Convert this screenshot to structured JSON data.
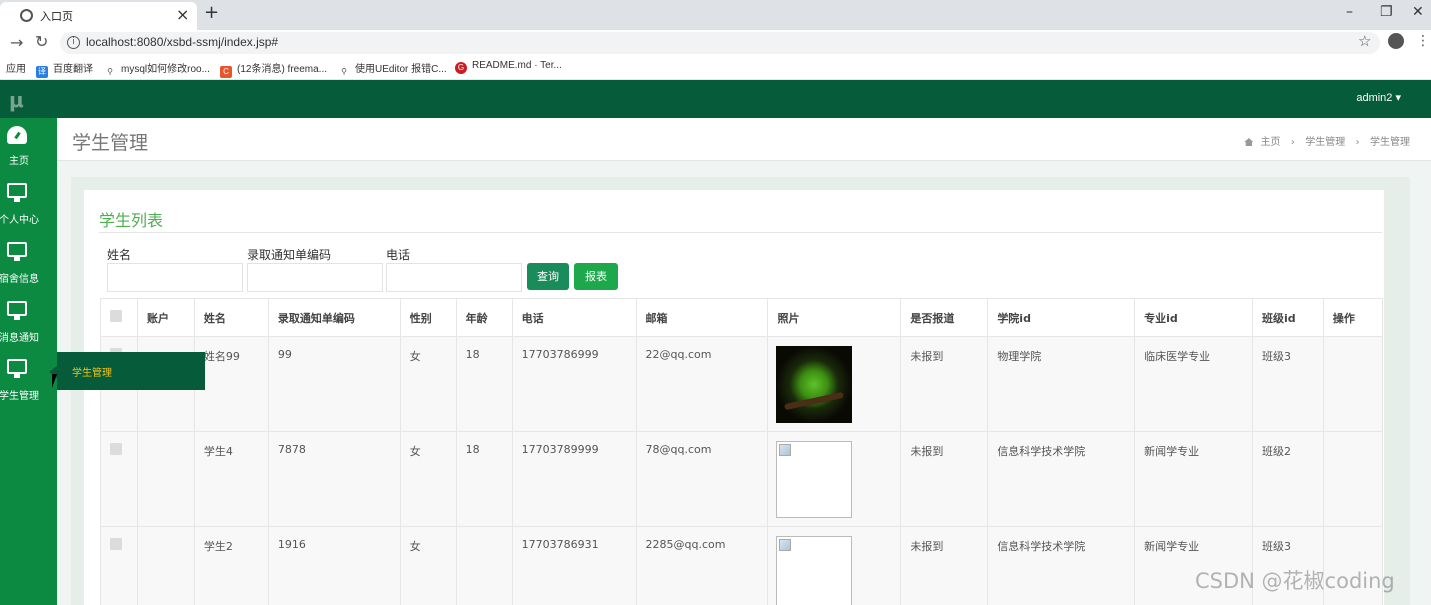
{
  "browser": {
    "tab_title": "入口页",
    "url": "localhost:8080/xsbd-ssmj/index.jsp#",
    "bookmarks": [
      "应用",
      "百度翻译",
      "mysql如何修改roo...",
      "(12条消息) freema...",
      "使用UEditor 报错C...",
      "README.md · Ter..."
    ]
  },
  "app": {
    "brand": "μ",
    "user": "admin2 ▾",
    "sidebar": [
      {
        "label": "主页",
        "icon": "dashboard-icon"
      },
      {
        "label": "个人中心",
        "icon": "monitor-icon"
      },
      {
        "label": "宿舍信息",
        "icon": "monitor-icon"
      },
      {
        "label": "消息通知",
        "icon": "monitor-icon"
      },
      {
        "label": "学生管理",
        "icon": "monitor-icon"
      }
    ],
    "flyout": "学生管理"
  },
  "page": {
    "title": "学生管理",
    "breadcrumb": [
      "主页",
      "学生管理",
      "学生管理"
    ],
    "card_title": "学生列表",
    "filters": {
      "name_label": "姓名",
      "notice_label": "录取通知单编码",
      "phone_label": "电话"
    },
    "buttons": {
      "query": "查询",
      "report": "报表"
    },
    "columns": [
      "",
      "账户",
      "姓名",
      "录取通知单编码",
      "性别",
      "年龄",
      "电话",
      "邮箱",
      "照片",
      "是否报道",
      "学院id",
      "专业id",
      "班级id",
      "操作"
    ],
    "rows": [
      {
        "account": "",
        "name": "姓名99",
        "code": "99",
        "gender": "女",
        "age": "18",
        "phone": "17703786999",
        "email": "22@qq.com",
        "photo": "frog",
        "reported": "未报到",
        "college": "物理学院",
        "major": "临床医学专业",
        "class": "班级3"
      },
      {
        "account": "",
        "name": "学生4",
        "code": "7878",
        "gender": "女",
        "age": "18",
        "phone": "17703789999",
        "email": "78@qq.com",
        "photo": "broken",
        "reported": "未报到",
        "college": "信息科学技术学院",
        "major": "新闻学专业",
        "class": "班级2"
      },
      {
        "account": "",
        "name": "学生2",
        "code": "1916",
        "gender": "女",
        "age": "",
        "phone": "17703786931",
        "email": "2285@qq.com",
        "photo": "broken",
        "reported": "未报到",
        "college": "信息科学技术学院",
        "major": "新闻学专业",
        "class": "班级3"
      }
    ]
  },
  "watermark": "CSDN @花椒coding"
}
